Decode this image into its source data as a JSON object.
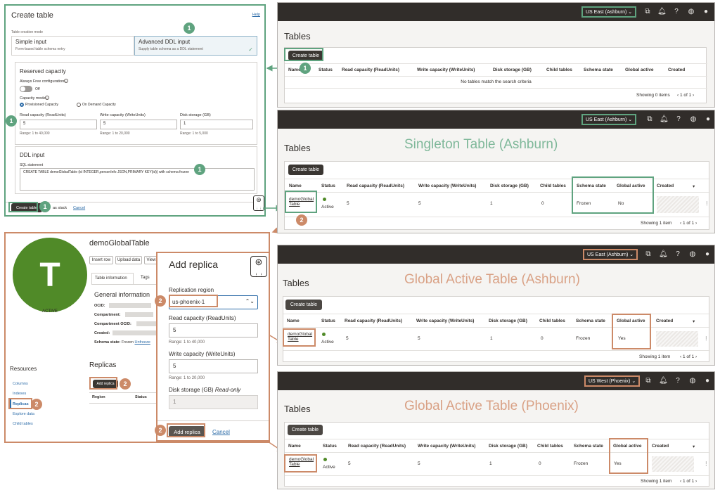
{
  "create_table": {
    "title": "Create table",
    "help": "Help",
    "mode_label": "Table creation mode",
    "simple_title": "Simple input",
    "simple_desc": "Form-based table schema entry",
    "advanced_title": "Advanced DDL input",
    "advanced_desc": "Supply table schema as a DDL statement",
    "reserved_title": "Reserved capacity",
    "always_free": "Always Free configuration",
    "toggle_state": "Off",
    "capacity_mode": "Capacity mode",
    "provisioned": "Provisioned Capacity",
    "on_demand": "On Demand Capacity",
    "read_label": "Read capacity (ReadUnits)",
    "read_value": "5",
    "read_range": "Range: 1 to 40,000",
    "write_label": "Write capacity (WriteUnits)",
    "write_value": "5",
    "write_range": "Range: 1 to 20,000",
    "disk_label": "Disk storage (GB)",
    "disk_value": "1",
    "disk_range": "Range: 1 to 5,000",
    "ddl_title": "DDL input",
    "sql_label": "SQL statement",
    "sql_value": "CREATE TABLE demoGlobalTable (id INTEGER,personInfo JSON,PRIMARY KEY(id)) with schema frozen",
    "create_button": "Create table",
    "save_stack": "as stack",
    "cancel": "Cancel"
  },
  "badges": {
    "one": "1",
    "two": "2"
  },
  "columns": [
    "Name",
    "Status",
    "Read capacity (ReadUnits)",
    "Write capacity (WriteUnits)",
    "Disk storage (GB)",
    "Child tables",
    "Schema state",
    "Global active",
    "Created"
  ],
  "tables_title": "Tables",
  "create_table_btn": "Create table",
  "panel1": {
    "region": "US East (Ashburn)",
    "empty": "No tables match the search criteria",
    "showing": "Showing 0 items",
    "page": "1 of 1"
  },
  "panel2": {
    "region": "US East (Ashburn)",
    "caption": "Singleton Table (Ashburn)",
    "row": {
      "name_1": "demoGlobal",
      "name_2": "Table",
      "status": "Active",
      "read": "5",
      "write": "5",
      "disk": "1",
      "child": "0",
      "schema": "Frozen",
      "global": "No"
    },
    "showing": "Showing 1 item",
    "page": "1 of 1"
  },
  "panel3": {
    "region": "US East (Ashburn)",
    "caption": "Global Active Table (Ashburn)",
    "row": {
      "name_1": "demoGlobal",
      "name_2": "Table",
      "status": "Active",
      "read": "5",
      "write": "5",
      "disk": "1",
      "child": "0",
      "schema": "Frozen",
      "global": "Yes"
    },
    "showing": "Showing 1 item",
    "page": "1 of 1"
  },
  "panel4": {
    "region": "US West (Phoenix)",
    "caption": "Global Active Table (Phoenix)",
    "row": {
      "name_1": "demoGlobal",
      "name_2": "Table",
      "status": "Active",
      "read": "5",
      "write": "5",
      "disk": "1",
      "child": "0",
      "schema": "Frozen",
      "global": "Yes"
    },
    "showing": "Showing 1 item",
    "page": "1 of 1"
  },
  "detail": {
    "title": "demoGlobalTable",
    "avatar": "T",
    "status": "ACTIVE",
    "insert_row": "Insert row",
    "upload_data": "Upload data",
    "view": "View",
    "tab_info": "Table information",
    "tab_tags": "Tags",
    "general_info": "General information",
    "ocid": "OCID:",
    "compartment": "Compartment:",
    "compartment_ocid": "Compartment OCID:",
    "created": "Created:",
    "schema_state": "Schema state:",
    "schema_value": "Frozen",
    "unfreeze": "Unfreeze",
    "resources": "Resources",
    "res_items": [
      "Columns",
      "Indexes",
      "Replicas",
      "Explore data",
      "Child tables"
    ],
    "replicas": "Replicas",
    "add_replica_btn": "Add replica",
    "col_region": "Region",
    "col_status": "Status"
  },
  "modal": {
    "title": "Add replica",
    "region_label": "Replication region",
    "region_value": "us-phoenix-1",
    "read_label": "Read capacity (ReadUnits)",
    "read_value": "5",
    "read_range": "Range: 1 to 40,000",
    "write_label": "Write capacity (WriteUnits)",
    "write_value": "5",
    "write_range": "Range: 1 to 20,000",
    "disk_label": "Disk storage (GB)",
    "disk_readonly": "Read-only",
    "disk_value": "1",
    "add_button": "Add replica",
    "cancel": "Cancel"
  },
  "colors": {
    "green": "#5fa37f",
    "orange": "#cc8a68",
    "dark": "#312d2a",
    "active": "#508a28"
  }
}
